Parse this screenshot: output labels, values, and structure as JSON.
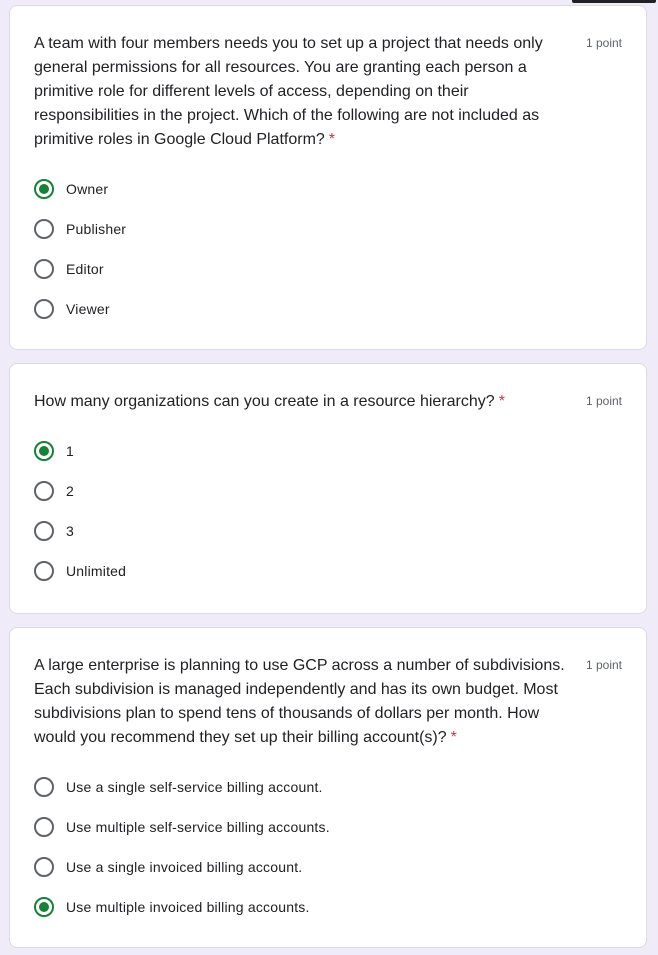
{
  "accent_color": "#188038",
  "required_color": "#d93025",
  "questions": [
    {
      "title": "A team with four members needs you to set up a project that needs only general permissions for all resources. You are granting each person a primitive role for different levels of access, depending on their responsibilities in the project. Which of the following are not included as primitive roles in Google Cloud Platform?",
      "required_mark": "*",
      "points": "1 point",
      "options": [
        "Owner",
        "Publisher",
        "Editor",
        "Viewer"
      ],
      "selected": "Owner"
    },
    {
      "title": "How many organizations can you create in a resource hierarchy?",
      "required_mark": "*",
      "points": "1 point",
      "options": [
        "1",
        "2",
        "3",
        "Unlimited"
      ],
      "selected": "1"
    },
    {
      "title": "A large enterprise is planning to use GCP across a number of subdivisions. Each subdivision is managed independently and has its own budget. Most subdivisions plan to spend tens of thousands of dollars per month. How would you recommend they set up their billing account(s)?",
      "required_mark": "*",
      "points": "1 point",
      "options": [
        "Use a single self-service billing account.",
        "Use multiple self-service billing accounts.",
        "Use a single invoiced billing account.",
        "Use multiple invoiced billing accounts."
      ],
      "selected": "Use multiple invoiced billing accounts."
    }
  ]
}
